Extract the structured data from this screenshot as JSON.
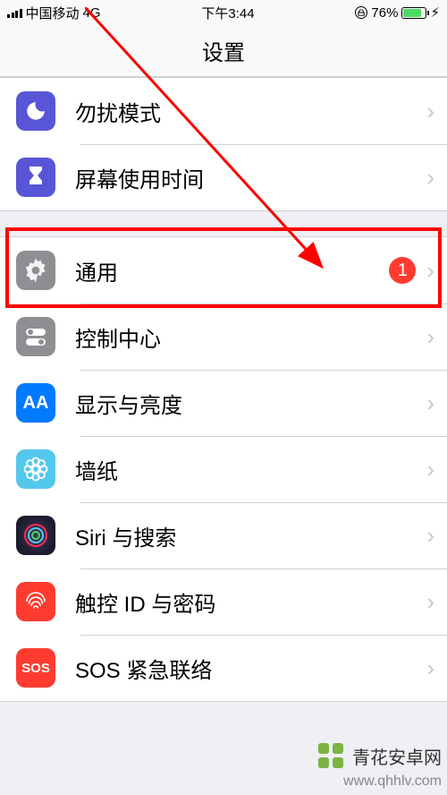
{
  "status_bar": {
    "carrier": "中国移动",
    "network": "4G",
    "time": "下午3:44",
    "battery_pct": "76%",
    "charging_glyph": "⚡︎"
  },
  "header": {
    "title": "设置"
  },
  "rows": {
    "dnd": {
      "label": "勿扰模式"
    },
    "screentime": {
      "label": "屏幕使用时间"
    },
    "general": {
      "label": "通用",
      "badge": "1"
    },
    "control": {
      "label": "控制中心"
    },
    "display": {
      "label": "显示与亮度"
    },
    "wallpaper": {
      "label": "墙纸"
    },
    "siri": {
      "label": "Siri 与搜索"
    },
    "touchid": {
      "label": "触控 ID 与密码"
    },
    "sos": {
      "label": "SOS 紧急联络",
      "icon_text": "SOS"
    }
  },
  "watermark": {
    "site_name": "青花安卓网",
    "url": "www.qhhlv.com"
  }
}
